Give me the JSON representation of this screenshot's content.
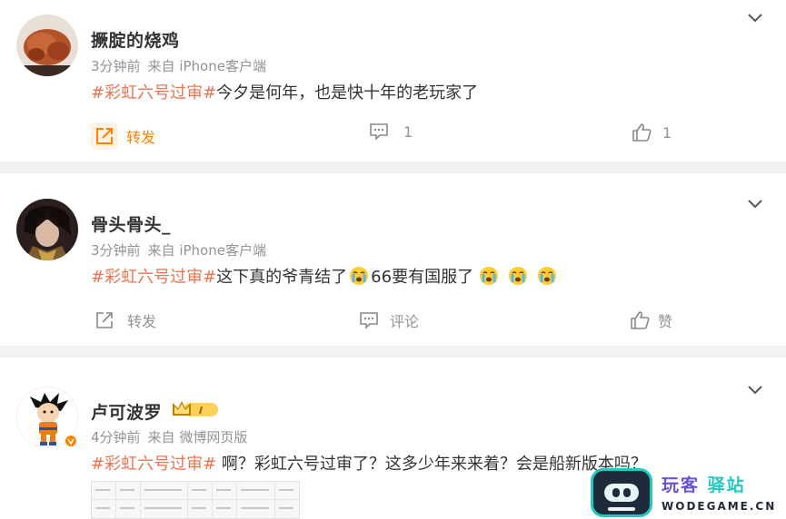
{
  "comments": [
    {
      "username": "撅腚的烧鸡",
      "time": "3分钟前",
      "source": "来自 iPhone客户端",
      "hashtag": "#彩虹六号过审#",
      "text": "今夕是何年，也是快十年的老玩家了",
      "repost_label": "转发",
      "comment_count": "1",
      "like_count": "1"
    },
    {
      "username": "骨头骨头_",
      "time": "3分钟前",
      "source": "来自 iPhone客户端",
      "hashtag": "#彩虹六号过审#",
      "text_a": "这下真的爷青结了",
      "text_b": "66要有国服了",
      "repost_label": "转发",
      "comment_label": "评论",
      "like_label": "赞"
    },
    {
      "username": "卢可波罗",
      "time": "4分钟前",
      "source": "来自 微博网页版",
      "hashtag": "#彩虹六号过审#",
      "text": " 啊？彩虹六号过审了？这多少年来来着？会是船新版本吗？"
    }
  ],
  "watermark": {
    "title_a": "玩客",
    "title_b": "驿站",
    "subtitle": "WODEGAME.CN"
  },
  "colors": {
    "hashtag": "#eb7350",
    "meta": "#939393",
    "repost_active": "#ff8200",
    "separator": "#f2f2f2"
  },
  "icons": [
    "chevron-down-icon",
    "repost-icon",
    "comment-icon",
    "like-icon",
    "crying-emoji-icon",
    "crown-level-badge-icon",
    "verified-badge-icon"
  ]
}
